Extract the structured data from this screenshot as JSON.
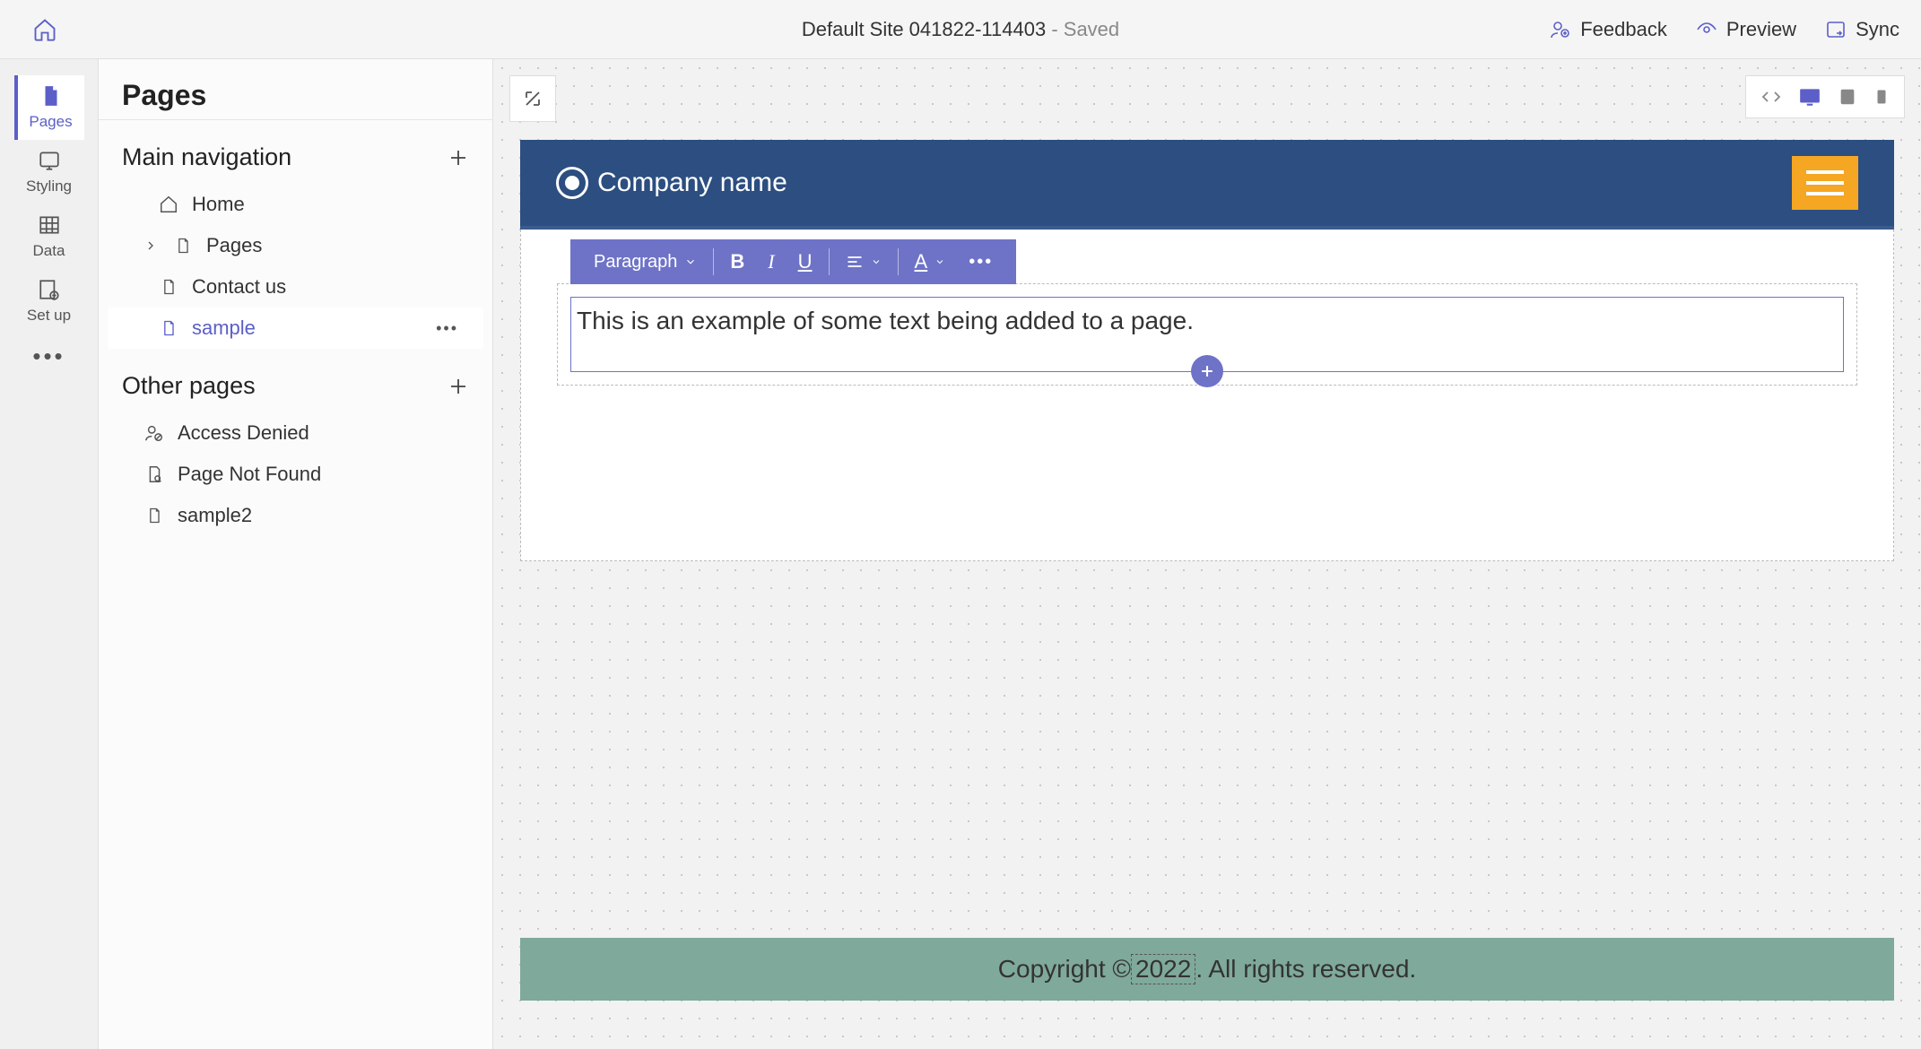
{
  "header": {
    "site_name": "Default Site 041822-114403",
    "status": "- Saved",
    "actions": {
      "feedback": "Feedback",
      "preview": "Preview",
      "sync": "Sync"
    }
  },
  "rail": {
    "pages": "Pages",
    "styling": "Styling",
    "data": "Data",
    "setup": "Set up"
  },
  "side": {
    "title": "Pages",
    "main_nav": "Main navigation",
    "other": "Other pages",
    "items": {
      "home": "Home",
      "pages": "Pages",
      "contact": "Contact us",
      "sample": "sample",
      "access": "Access Denied",
      "notfound": "Page Not Found",
      "sample2": "sample2"
    }
  },
  "editor": {
    "toolbar": {
      "style": "Paragraph"
    }
  },
  "preview": {
    "brand": "Company name",
    "body_text": "This is an example of some text being added to a page.",
    "footer_pre": "Copyright © ",
    "footer_year": "2022",
    "footer_post": ". All rights reserved."
  }
}
